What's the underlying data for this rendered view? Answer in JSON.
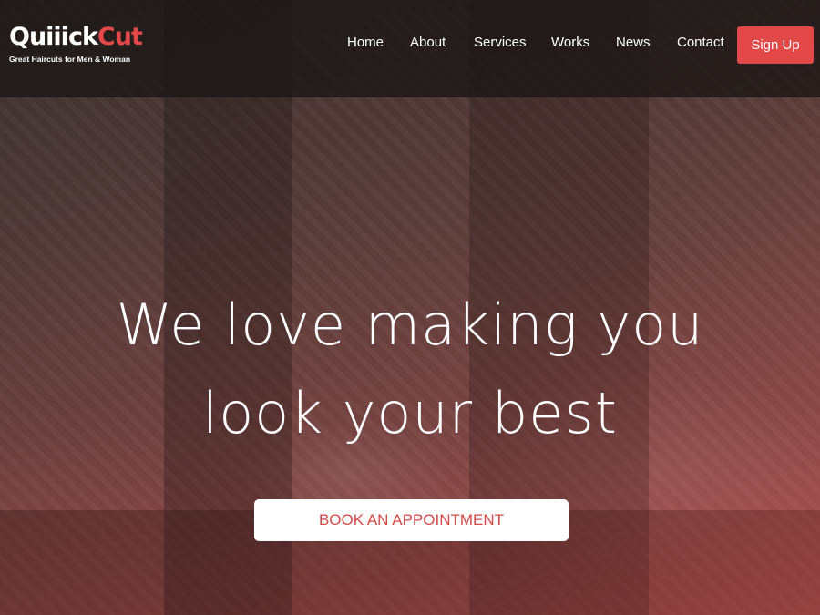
{
  "brand": {
    "name_main": "Quiiick",
    "name_accent": "Cut",
    "tagline": "Great Haircuts for Men & Woman",
    "accent_color": "#e24848"
  },
  "nav": {
    "items": [
      {
        "label": "Home"
      },
      {
        "label": "About"
      },
      {
        "label": "Services"
      },
      {
        "label": "Works"
      },
      {
        "label": "News"
      },
      {
        "label": "Contact"
      }
    ],
    "signup_label": "Sign Up"
  },
  "hero": {
    "headline_line1": "We love making you",
    "headline_line2": "look your best",
    "cta_label": "BOOK AN APPOINTMENT"
  }
}
